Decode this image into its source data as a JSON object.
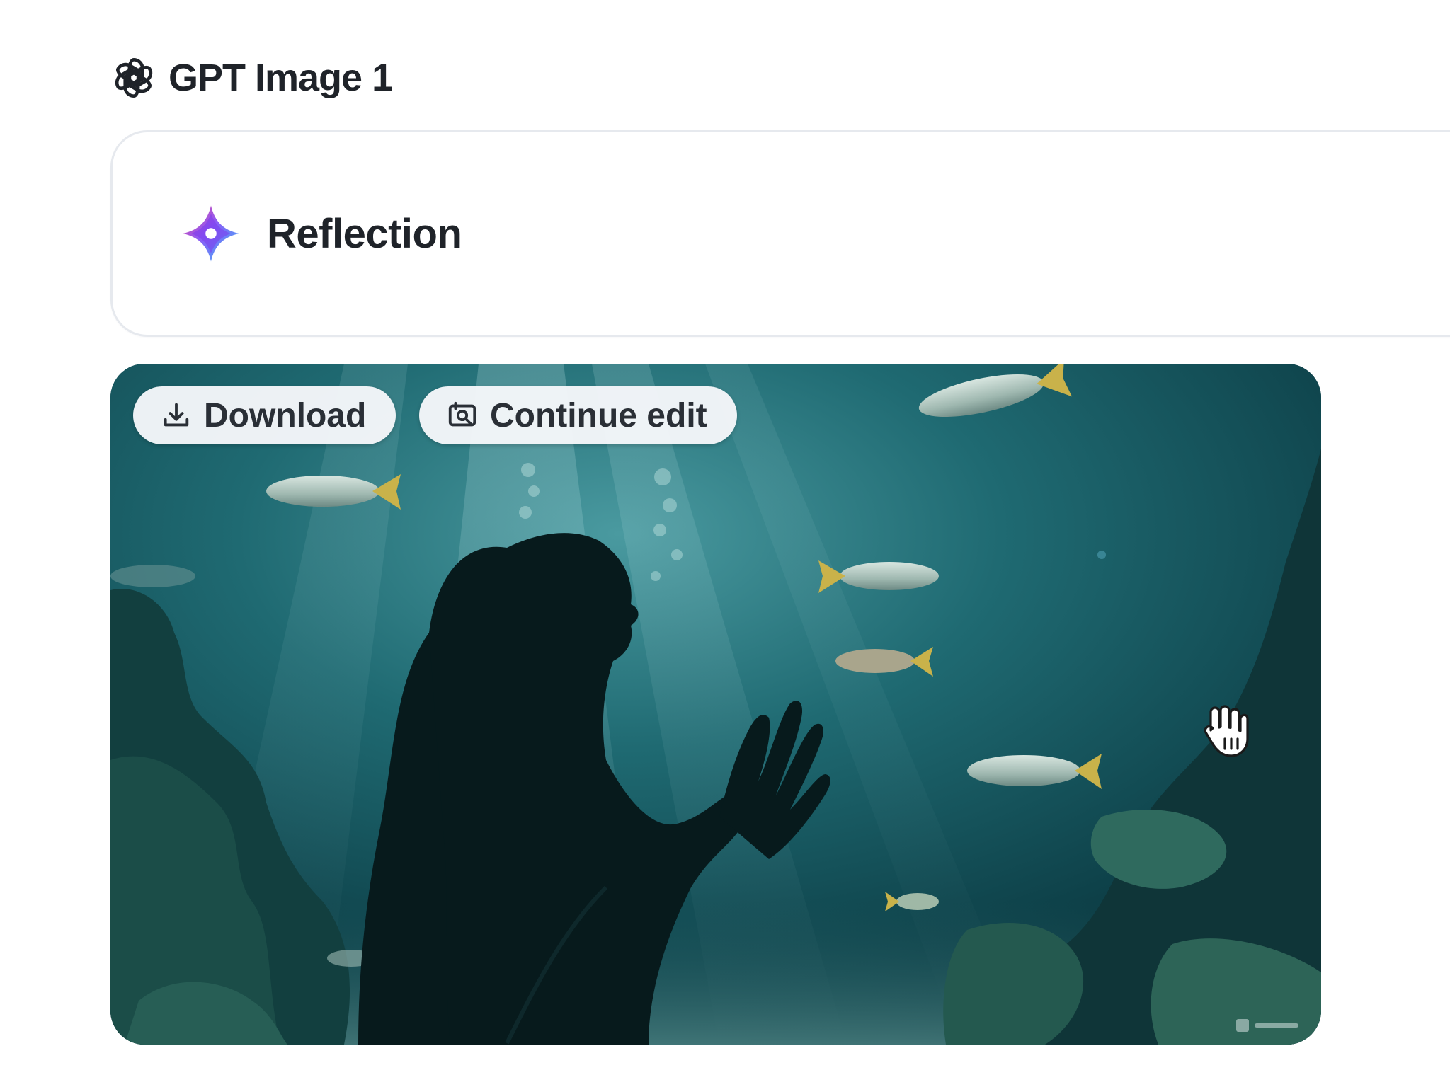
{
  "model": {
    "name": "GPT Image 1",
    "logo_icon": "openai-logo-icon"
  },
  "prompt": {
    "icon": "sparkle-icon",
    "text": "Reflection"
  },
  "image": {
    "actions": [
      {
        "label": "Download",
        "icon": "download-icon"
      },
      {
        "label": "Continue edit",
        "icon": "edit-image-icon"
      }
    ]
  },
  "colors": {
    "text": "#1f2329",
    "border": "#e6e9ee",
    "button_bg": "#f4f6f9",
    "sparkle_purple": "#8b5cf6",
    "sparkle_blue": "#3b82f6",
    "sparkle_pink": "#ec4899"
  }
}
